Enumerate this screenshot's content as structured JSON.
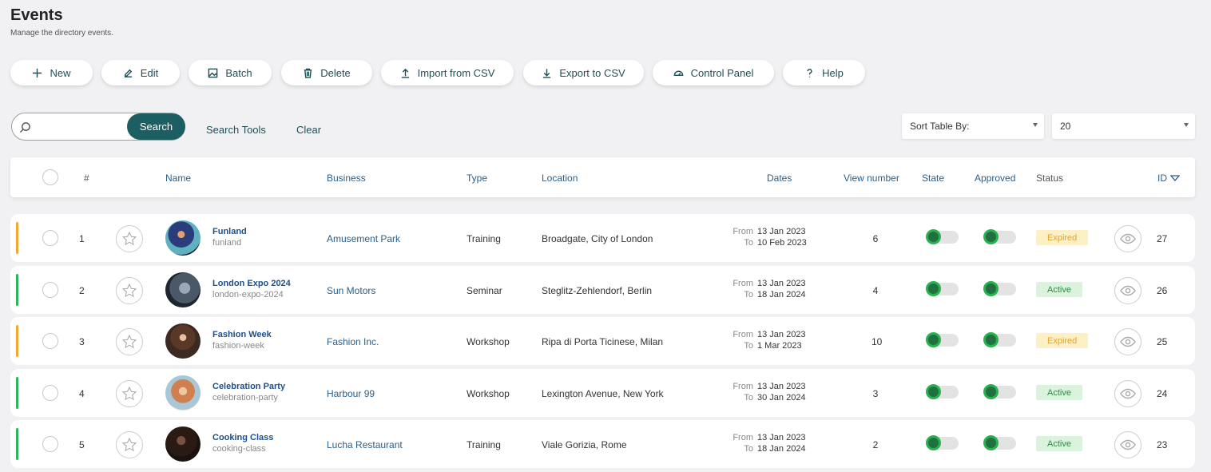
{
  "page": {
    "title": "Events",
    "subtitle": "Manage the directory events."
  },
  "toolbar": [
    {
      "label": "New",
      "icon": "plus-icon"
    },
    {
      "label": "Edit",
      "icon": "edit-icon"
    },
    {
      "label": "Batch",
      "icon": "image-icon"
    },
    {
      "label": "Delete",
      "icon": "trash-icon"
    },
    {
      "label": "Import from CSV",
      "icon": "upload-icon"
    },
    {
      "label": "Export to CSV",
      "icon": "download-icon"
    },
    {
      "label": "Control Panel",
      "icon": "gauge-icon"
    },
    {
      "label": "Help",
      "icon": "help-icon"
    }
  ],
  "search": {
    "button_label": "Search",
    "tools_label": "Search Tools",
    "clear_label": "Clear",
    "placeholder": ""
  },
  "sort": {
    "label": "Sort Table By:",
    "page_size": "20"
  },
  "columns": {
    "num": "#",
    "name": "Name",
    "business": "Business",
    "type": "Type",
    "location": "Location",
    "dates": "Dates",
    "views": "View number",
    "state": "State",
    "approved": "Approved",
    "status": "Status",
    "id": "ID"
  },
  "dates_labels": {
    "from": "From",
    "to": "To"
  },
  "colors": {
    "accent": "#1d5e62",
    "expired": "#f0a830",
    "active": "#2eb360"
  },
  "rows": [
    {
      "num": "1",
      "name": "Funland",
      "slug": "funland",
      "business": "Amusement Park",
      "type": "Training",
      "location": "Broadgate, City of London",
      "from": "13 Jan 2023",
      "to": "10 Feb 2023",
      "views": "6",
      "status": "Expired",
      "id": "27"
    },
    {
      "num": "2",
      "name": "London Expo 2024",
      "slug": "london-expo-2024",
      "business": "Sun Motors",
      "type": "Seminar",
      "location": "Steglitz-Zehlendorf, Berlin",
      "from": "13 Jan 2023",
      "to": "18 Jan 2024",
      "views": "4",
      "status": "Active",
      "id": "26"
    },
    {
      "num": "3",
      "name": "Fashion Week",
      "slug": "fashion-week",
      "business": "Fashion Inc.",
      "type": "Workshop",
      "location": "Ripa di Porta Ticinese, Milan",
      "from": "13 Jan 2023",
      "to": "1 Mar 2023",
      "views": "10",
      "status": "Expired",
      "id": "25"
    },
    {
      "num": "4",
      "name": "Celebration Party",
      "slug": "celebration-party",
      "business": "Harbour 99",
      "type": "Workshop",
      "location": "Lexington Avenue, New York",
      "from": "13 Jan 2023",
      "to": "30 Jan 2024",
      "views": "3",
      "status": "Active",
      "id": "24"
    },
    {
      "num": "5",
      "name": "Cooking Class",
      "slug": "cooking-class",
      "business": "Lucha Restaurant",
      "type": "Training",
      "location": "Viale Gorizia, Rome",
      "from": "13 Jan 2023",
      "to": "18 Jan 2024",
      "views": "2",
      "status": "Active",
      "id": "23"
    }
  ]
}
